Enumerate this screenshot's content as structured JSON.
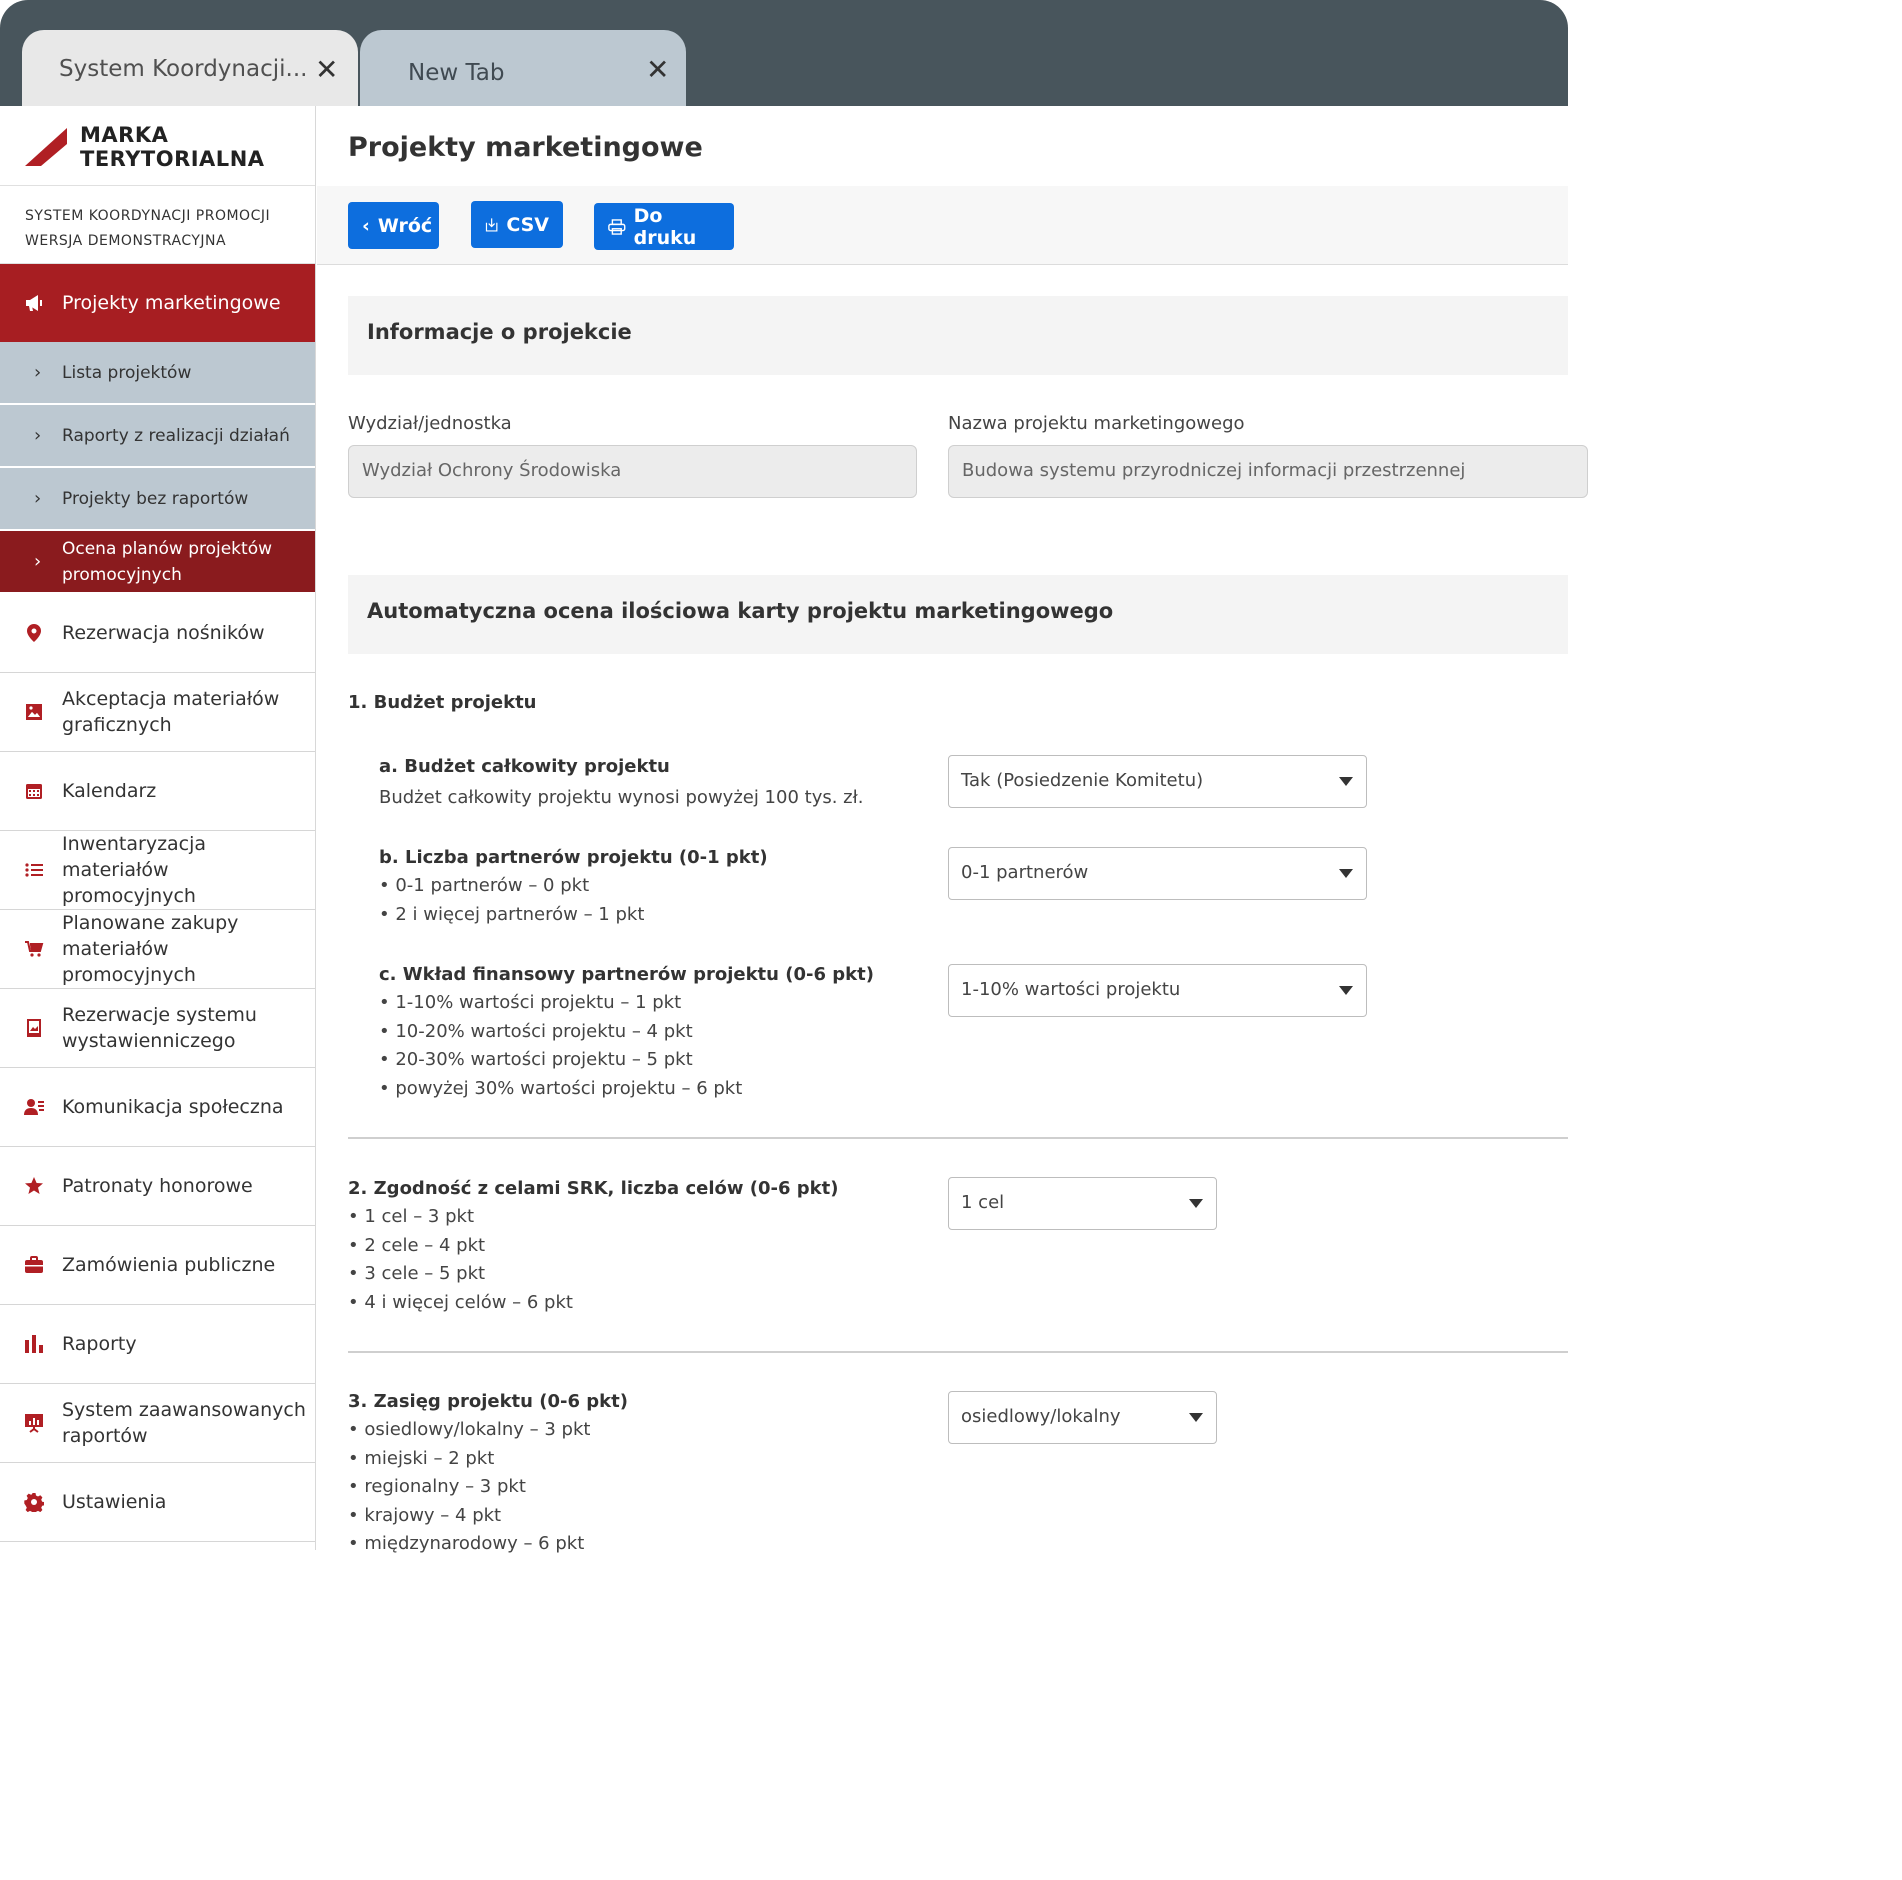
{
  "browser": {
    "tabs": [
      {
        "title": "System Koordynacji...",
        "close": "✕"
      },
      {
        "title": "New Tab",
        "close": "✕"
      }
    ]
  },
  "brand": {
    "line1": "MARKA",
    "line2": "TERYTORIALNA",
    "system_line1": "SYSTEM KOORDYNACJI PROMOCJI",
    "system_line2": "WERSJA DEMONSTRACYJNA",
    "accent": "#a71e22"
  },
  "sidebar": {
    "active": "Projekty marketingowe",
    "subitems": [
      "Lista projektów",
      "Raporty z realizacji działań",
      "Projekty bez raportów",
      "Ocena planów projektów promocyjnych"
    ],
    "items": [
      {
        "label": "Rezerwacja nośników",
        "icon": "map-pin-icon"
      },
      {
        "label": "Akceptacja materiałów graficznych",
        "icon": "image-icon"
      },
      {
        "label": "Kalendarz",
        "icon": "calendar-icon"
      },
      {
        "label": "Inwentaryzacja materiałów promocyjnych",
        "icon": "list-icon"
      },
      {
        "label": "Planowane zakupy materiałów promocyjnych",
        "icon": "cart-icon"
      },
      {
        "label": "Rezerwacje systemu wystawienniczego",
        "icon": "easel-icon"
      },
      {
        "label": "Komunikacja społeczna",
        "icon": "people-icon"
      },
      {
        "label": "Patronaty honorowe",
        "icon": "star-icon"
      },
      {
        "label": "Zamówienia publiczne",
        "icon": "briefcase-icon"
      },
      {
        "label": "Raporty",
        "icon": "bar-chart-icon"
      },
      {
        "label": "System zaawansowanych raportów",
        "icon": "presentation-icon"
      },
      {
        "label": "Ustawienia",
        "icon": "gear-icon"
      }
    ]
  },
  "main": {
    "title": "Projekty marketingowe",
    "toolbar": {
      "back": "Wróć",
      "csv": "CSV",
      "print": "Do druku"
    },
    "info_section": "Informacje o projekcie",
    "fields": {
      "unit_label": "Wydział/jednostka",
      "unit_value": "Wydział Ochrony Środowiska",
      "name_label": "Nazwa projektu marketingowego",
      "name_value": "Budowa systemu przyrodniczej informacji przestrzennej"
    },
    "eval_section": "Automatyczna ocena ilościowa karty projektu marketingowego",
    "q1": {
      "title": "1. Budżet projektu",
      "a_title": "a. Budżet całkowity projektu",
      "a_desc": "Budżet całkowity projektu wynosi powyżej 100 tys. zł.",
      "a_value": "Tak (Posiedzenie Komitetu)",
      "b_title": "b. Liczba partnerów projektu (0-1 pkt)",
      "b_opts": [
        "• 0-1 partnerów – 0 pkt",
        "• 2 i więcej partnerów – 1 pkt"
      ],
      "b_value": "0-1 partnerów",
      "c_title": "c. Wkład finansowy partnerów projektu (0-6 pkt)",
      "c_opts": [
        "• 1-10% wartości projektu – 1 pkt",
        "• 10-20% wartości projektu – 4 pkt",
        "• 20-30% wartości projektu – 5 pkt",
        "• powyżej 30% wartości projektu – 6 pkt"
      ],
      "c_value": "1-10% wartości projektu"
    },
    "q2": {
      "title": "2. Zgodność z celami SRK, liczba celów (0-6 pkt)",
      "opts": [
        "• 1 cel – 3 pkt",
        "• 2 cele – 4 pkt",
        "• 3 cele – 5 pkt",
        "• 4 i więcej celów – 6 pkt"
      ],
      "value": "1 cel"
    },
    "q3": {
      "title": "3. Zasięg projektu (0-6 pkt)",
      "opts": [
        "• osiedlowy/lokalny – 3 pkt",
        "• miejski – 2 pkt",
        "• regionalny – 3 pkt",
        "• krajowy – 4 pkt",
        "• międzynarodowy – 6 pkt"
      ],
      "value": "osiedlowy/lokalny"
    }
  }
}
